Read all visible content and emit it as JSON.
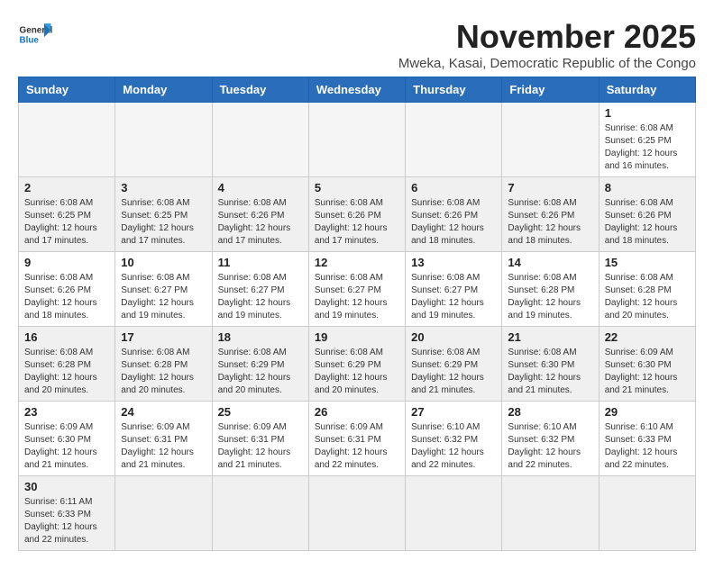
{
  "header": {
    "logo_line1": "General",
    "logo_line2": "Blue",
    "month_title": "November 2025",
    "subtitle": "Mweka, Kasai, Democratic Republic of the Congo"
  },
  "calendar": {
    "days_of_week": [
      "Sunday",
      "Monday",
      "Tuesday",
      "Wednesday",
      "Thursday",
      "Friday",
      "Saturday"
    ],
    "weeks": [
      [
        {
          "day": "",
          "info": ""
        },
        {
          "day": "",
          "info": ""
        },
        {
          "day": "",
          "info": ""
        },
        {
          "day": "",
          "info": ""
        },
        {
          "day": "",
          "info": ""
        },
        {
          "day": "",
          "info": ""
        },
        {
          "day": "1",
          "info": "Sunrise: 6:08 AM\nSunset: 6:25 PM\nDaylight: 12 hours\nand 16 minutes."
        }
      ],
      [
        {
          "day": "2",
          "info": "Sunrise: 6:08 AM\nSunset: 6:25 PM\nDaylight: 12 hours\nand 17 minutes."
        },
        {
          "day": "3",
          "info": "Sunrise: 6:08 AM\nSunset: 6:25 PM\nDaylight: 12 hours\nand 17 minutes."
        },
        {
          "day": "4",
          "info": "Sunrise: 6:08 AM\nSunset: 6:26 PM\nDaylight: 12 hours\nand 17 minutes."
        },
        {
          "day": "5",
          "info": "Sunrise: 6:08 AM\nSunset: 6:26 PM\nDaylight: 12 hours\nand 17 minutes."
        },
        {
          "day": "6",
          "info": "Sunrise: 6:08 AM\nSunset: 6:26 PM\nDaylight: 12 hours\nand 18 minutes."
        },
        {
          "day": "7",
          "info": "Sunrise: 6:08 AM\nSunset: 6:26 PM\nDaylight: 12 hours\nand 18 minutes."
        },
        {
          "day": "8",
          "info": "Sunrise: 6:08 AM\nSunset: 6:26 PM\nDaylight: 12 hours\nand 18 minutes."
        }
      ],
      [
        {
          "day": "9",
          "info": "Sunrise: 6:08 AM\nSunset: 6:26 PM\nDaylight: 12 hours\nand 18 minutes."
        },
        {
          "day": "10",
          "info": "Sunrise: 6:08 AM\nSunset: 6:27 PM\nDaylight: 12 hours\nand 19 minutes."
        },
        {
          "day": "11",
          "info": "Sunrise: 6:08 AM\nSunset: 6:27 PM\nDaylight: 12 hours\nand 19 minutes."
        },
        {
          "day": "12",
          "info": "Sunrise: 6:08 AM\nSunset: 6:27 PM\nDaylight: 12 hours\nand 19 minutes."
        },
        {
          "day": "13",
          "info": "Sunrise: 6:08 AM\nSunset: 6:27 PM\nDaylight: 12 hours\nand 19 minutes."
        },
        {
          "day": "14",
          "info": "Sunrise: 6:08 AM\nSunset: 6:28 PM\nDaylight: 12 hours\nand 19 minutes."
        },
        {
          "day": "15",
          "info": "Sunrise: 6:08 AM\nSunset: 6:28 PM\nDaylight: 12 hours\nand 20 minutes."
        }
      ],
      [
        {
          "day": "16",
          "info": "Sunrise: 6:08 AM\nSunset: 6:28 PM\nDaylight: 12 hours\nand 20 minutes."
        },
        {
          "day": "17",
          "info": "Sunrise: 6:08 AM\nSunset: 6:28 PM\nDaylight: 12 hours\nand 20 minutes."
        },
        {
          "day": "18",
          "info": "Sunrise: 6:08 AM\nSunset: 6:29 PM\nDaylight: 12 hours\nand 20 minutes."
        },
        {
          "day": "19",
          "info": "Sunrise: 6:08 AM\nSunset: 6:29 PM\nDaylight: 12 hours\nand 20 minutes."
        },
        {
          "day": "20",
          "info": "Sunrise: 6:08 AM\nSunset: 6:29 PM\nDaylight: 12 hours\nand 21 minutes."
        },
        {
          "day": "21",
          "info": "Sunrise: 6:08 AM\nSunset: 6:30 PM\nDaylight: 12 hours\nand 21 minutes."
        },
        {
          "day": "22",
          "info": "Sunrise: 6:09 AM\nSunset: 6:30 PM\nDaylight: 12 hours\nand 21 minutes."
        }
      ],
      [
        {
          "day": "23",
          "info": "Sunrise: 6:09 AM\nSunset: 6:30 PM\nDaylight: 12 hours\nand 21 minutes."
        },
        {
          "day": "24",
          "info": "Sunrise: 6:09 AM\nSunset: 6:31 PM\nDaylight: 12 hours\nand 21 minutes."
        },
        {
          "day": "25",
          "info": "Sunrise: 6:09 AM\nSunset: 6:31 PM\nDaylight: 12 hours\nand 21 minutes."
        },
        {
          "day": "26",
          "info": "Sunrise: 6:09 AM\nSunset: 6:31 PM\nDaylight: 12 hours\nand 22 minutes."
        },
        {
          "day": "27",
          "info": "Sunrise: 6:10 AM\nSunset: 6:32 PM\nDaylight: 12 hours\nand 22 minutes."
        },
        {
          "day": "28",
          "info": "Sunrise: 6:10 AM\nSunset: 6:32 PM\nDaylight: 12 hours\nand 22 minutes."
        },
        {
          "day": "29",
          "info": "Sunrise: 6:10 AM\nSunset: 6:33 PM\nDaylight: 12 hours\nand 22 minutes."
        }
      ],
      [
        {
          "day": "30",
          "info": "Sunrise: 6:11 AM\nSunset: 6:33 PM\nDaylight: 12 hours\nand 22 minutes."
        },
        {
          "day": "",
          "info": ""
        },
        {
          "day": "",
          "info": ""
        },
        {
          "day": "",
          "info": ""
        },
        {
          "day": "",
          "info": ""
        },
        {
          "day": "",
          "info": ""
        },
        {
          "day": "",
          "info": ""
        }
      ]
    ]
  }
}
